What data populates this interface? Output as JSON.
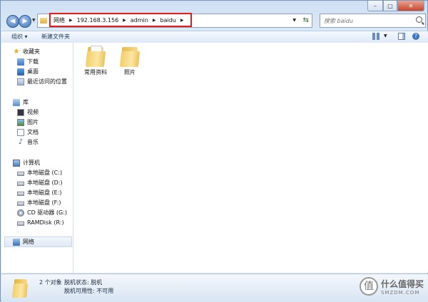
{
  "window": {
    "controls": {
      "minimize": "–",
      "maximize": "□",
      "close": "✕"
    }
  },
  "address": {
    "crumbs": [
      "网络",
      "192.168.3.156",
      "admin",
      "baidu"
    ]
  },
  "search": {
    "placeholder": "搜索 baidu"
  },
  "toolbar": {
    "organize_label": "组织 ▾",
    "new_folder_label": "新建文件夹"
  },
  "sidebar": {
    "favorites": {
      "label": "收藏夹",
      "items": [
        "下载",
        "桌面",
        "最近访问的位置"
      ]
    },
    "libraries": {
      "label": "库",
      "items": [
        "视频",
        "图片",
        "文档",
        "音乐"
      ]
    },
    "computer": {
      "label": "计算机",
      "items": [
        "本地磁盘 (C:)",
        "本地磁盘 (D:)",
        "本地磁盘 (E:)",
        "本地磁盘 (F:)",
        "CD 驱动器 (G:)",
        "RAMDisk (R:)"
      ]
    },
    "network": {
      "label": "网络"
    }
  },
  "files": [
    {
      "name": "常用资料"
    },
    {
      "name": "照片"
    }
  ],
  "status": {
    "count": "2 个对象",
    "line1": "脱机状态: 脱机",
    "line2": "脱机可用性: 不可用"
  },
  "watermark": {
    "line1": "什么值得买",
    "line2": "SMZDM.COM",
    "logo": "值"
  }
}
